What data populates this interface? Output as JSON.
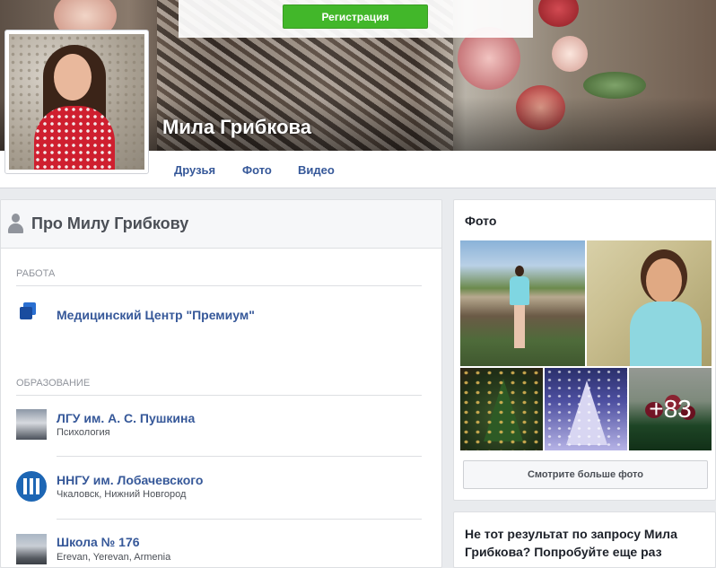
{
  "header": {
    "register_label": "Регистрация",
    "profile_name": "Мила Грибкова"
  },
  "nav": {
    "tabs": [
      {
        "label": "Друзья"
      },
      {
        "label": "Фото"
      },
      {
        "label": "Видео"
      }
    ]
  },
  "about": {
    "title": "Про Милу Грибкову",
    "work_label": "РАБОТА",
    "work": [
      {
        "title": "Медицинский Центр \"Премиум\""
      }
    ],
    "education_label": "ОБРАЗОВАНИЕ",
    "education": [
      {
        "title": "ЛГУ им. А. С. Пушкина",
        "subtitle": "Психология"
      },
      {
        "title": "ННГУ им. Лобачевского",
        "subtitle": "Чкаловск, Нижний Новгород"
      },
      {
        "title": "Школа № 176",
        "subtitle": "Erevan, Yerevan, Armenia"
      }
    ]
  },
  "photos": {
    "title": "Фото",
    "more_count": "+83",
    "more_button": "Смотрите больше фото"
  },
  "suggestion": {
    "text": "Не тот результат по запросу Мила Грибкова? Попробуйте еще раз"
  },
  "colors": {
    "link": "#365899",
    "register_green": "#42b72a",
    "page_bg": "#e9ebee"
  }
}
